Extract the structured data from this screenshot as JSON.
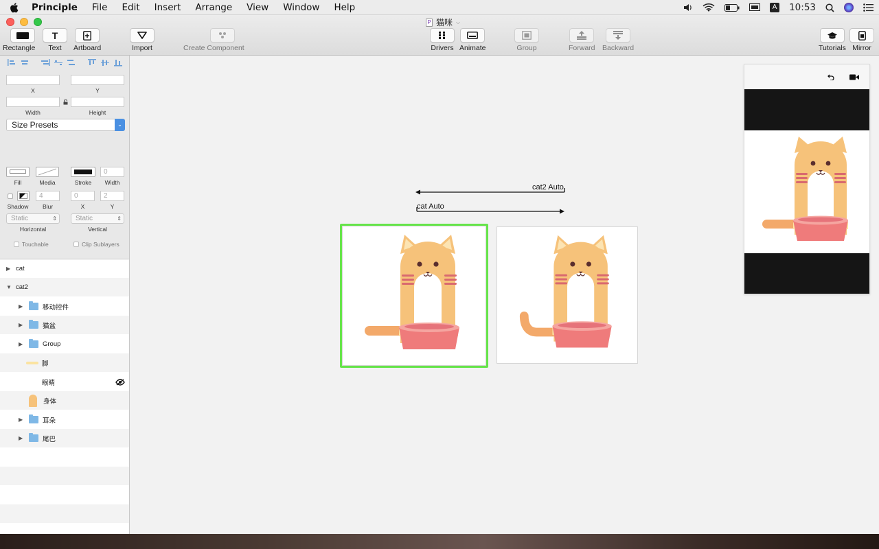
{
  "menubar": {
    "items": [
      "Principle",
      "File",
      "Edit",
      "Insert",
      "Arrange",
      "View",
      "Window",
      "Help"
    ],
    "clock": "10:53",
    "input_source": "A"
  },
  "window": {
    "title": "猫咪",
    "doc_icon_letter": "P"
  },
  "toolbar": {
    "rectangle": "Rectangle",
    "text": "Text",
    "text_icon": "T",
    "artboard": "Artboard",
    "import": "Import",
    "create_component": "Create Component",
    "drivers": "Drivers",
    "animate": "Animate",
    "group": "Group",
    "forward": "Forward",
    "backward": "Backward",
    "tutorials": "Tutorials",
    "mirror": "Mirror"
  },
  "inspector": {
    "x_label": "X",
    "y_label": "Y",
    "width_label": "Width",
    "height_label": "Height",
    "size_presets": "Size Presets",
    "fill_label": "Fill",
    "media_label": "Media",
    "stroke_label": "Stroke",
    "stroke_width_label": "Width",
    "stroke_width_value": "0",
    "shadow_label": "Shadow",
    "blur_label": "Blur",
    "blur_value": "4",
    "shadow_x_label": "X",
    "shadow_x_value": "0",
    "shadow_y_label": "Y",
    "shadow_y_value": "2",
    "horizontal_value": "Static",
    "horizontal_label": "Horizontal",
    "vertical_value": "Static",
    "vertical_label": "Vertical",
    "touchable": "Touchable",
    "clip_sublayers": "Clip Sublayers"
  },
  "layers": [
    {
      "name": "cat",
      "type": "artboard",
      "indent": 0,
      "expanded": false
    },
    {
      "name": "cat2",
      "type": "artboard",
      "indent": 0,
      "expanded": true
    },
    {
      "name": "移动控件",
      "type": "group",
      "indent": 1
    },
    {
      "name": "猫盆",
      "type": "group",
      "indent": 1
    },
    {
      "name": "Group",
      "type": "group",
      "indent": 1
    },
    {
      "name": "脚",
      "type": "shape-line",
      "indent": 1
    },
    {
      "name": "眼睛",
      "type": "hidden",
      "indent": 1
    },
    {
      "name": "身体",
      "type": "shape-body",
      "indent": 1
    },
    {
      "name": "耳朵",
      "type": "group",
      "indent": 1
    },
    {
      "name": "尾巴",
      "type": "group",
      "indent": 1
    }
  ],
  "canvas": {
    "connection_top": "cat2 Auto",
    "connection_bottom": "cat Auto",
    "selection_color": "#66e44a"
  },
  "colors": {
    "cat_orange": "#f6c27a",
    "cat_face": "#ffffff",
    "bowl_red": "#ef7b7b",
    "stripe": "#d9696f"
  }
}
